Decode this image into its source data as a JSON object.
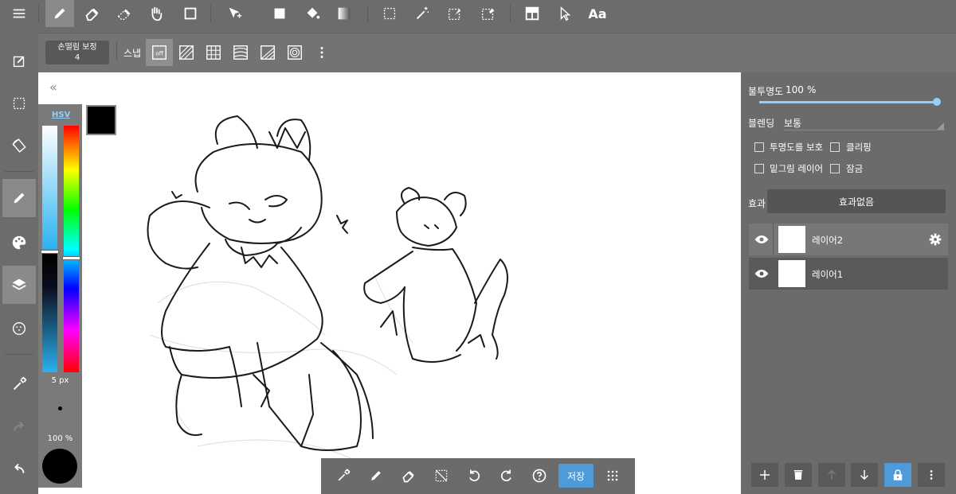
{
  "top_toolbar": {
    "items": [
      {
        "icon": "menu-icon"
      },
      {
        "icon": "pencil-icon",
        "active": true
      },
      {
        "icon": "eraser-icon"
      },
      {
        "icon": "blur-eraser-icon"
      },
      {
        "icon": "hand-icon"
      },
      {
        "icon": "square-outline-icon"
      },
      {
        "icon": "move-icon"
      },
      {
        "icon": "fill-square-icon"
      },
      {
        "icon": "bucket-icon"
      },
      {
        "icon": "gradient-icon"
      },
      {
        "icon": "select-rect-icon"
      },
      {
        "icon": "magic-wand-icon"
      },
      {
        "icon": "select-pen-icon"
      },
      {
        "icon": "select-eraser-icon"
      },
      {
        "icon": "panel-icon"
      },
      {
        "icon": "pointer-icon"
      },
      {
        "icon": "text-icon",
        "label": "Aa"
      }
    ]
  },
  "sub_toolbar": {
    "stabilizer_label": "손떨림 보정",
    "stabilizer_value": "4",
    "snap_label": "스냅",
    "snap_off_label": "off",
    "snap_options": [
      "snap-off-icon",
      "snap-parallel-icon",
      "snap-grid-icon",
      "snap-curve-icon",
      "snap-perspective-icon",
      "snap-concentric-icon"
    ]
  },
  "left_sidebar": {
    "items": [
      "edit-icon",
      "select-icon",
      "rotate-canvas-icon",
      "brush-icon",
      "palette-icon",
      "layers-icon",
      "texture-icon",
      "eyedropper-icon",
      "redo-icon",
      "undo-icon"
    ],
    "selected": [
      "brush-icon",
      "layers-icon"
    ]
  },
  "color_panel": {
    "mode_label": "HSV",
    "current_color": "#000000",
    "brush_size": "5 px",
    "brush_opacity": "100 %"
  },
  "floating_bar": {
    "items": [
      "eyedropper-icon",
      "pen-icon",
      "eraser-icon",
      "deselect-icon",
      "undo-icon",
      "redo-icon",
      "help-icon"
    ],
    "save_label": "저장",
    "more_icon": "grid-dots-icon"
  },
  "layer_panel": {
    "opacity_label": "불투명도",
    "opacity_value": "100",
    "opacity_unit": "%",
    "opacity_fraction": 1.0,
    "blend_label": "블렌딩",
    "blend_value": "보통",
    "checkboxes": [
      {
        "label": "투명도를 보호",
        "checked": false
      },
      {
        "label": "클리핑",
        "checked": false
      },
      {
        "label": "밑그림 레이어",
        "checked": false
      },
      {
        "label": "잠금",
        "checked": false
      }
    ],
    "effect_label": "효과",
    "effect_value": "효과없음",
    "layers": [
      {
        "name": "레이어2",
        "selected": true
      },
      {
        "name": "레이어1",
        "selected": false
      }
    ],
    "actions": [
      "add-layer-icon",
      "delete-layer-icon",
      "move-up-icon",
      "move-down-icon",
      "lock-icon",
      "more-vert-icon"
    ]
  },
  "colors": {
    "accent": "#4f9ad8",
    "slider": "#8fd0ff",
    "toolbar": "#6c6c6c"
  }
}
